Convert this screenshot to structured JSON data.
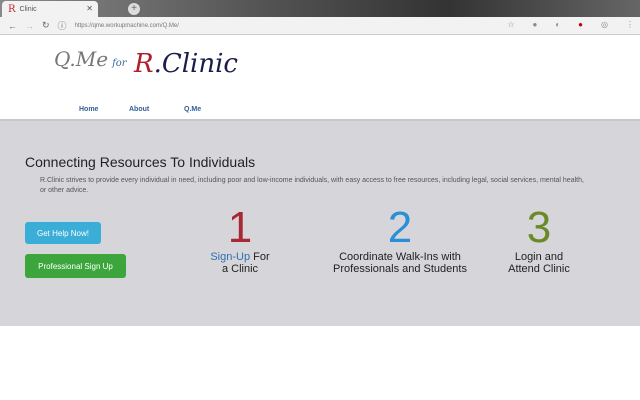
{
  "browser": {
    "tab_title": "Clinic",
    "url": "https://qme.workupmachine.com/Q.Me/"
  },
  "logo": {
    "qme": "Q.Me",
    "for": "for",
    "r": "R",
    "clinic": ".Clinic"
  },
  "nav": [
    "Home",
    "About",
    "Q.Me"
  ],
  "hero": {
    "title": "Connecting Resources To Individuals",
    "description": "R.Clinic strives to provide every individual in need, including poor and low-income individuals, with easy access to free resources, including legal, social services, mental health, or other advice.",
    "get_help": "Get Help Now!",
    "pro_signup": "Professional Sign Up",
    "steps": [
      {
        "num": "1",
        "link": "Sign-Up",
        "text1": " For",
        "text2": "a Clinic",
        "color": "#a82935"
      },
      {
        "num": "2",
        "text1": "Coordinate Walk-Ins with",
        "text2": "Professionals and Students",
        "color": "#2a8fd6"
      },
      {
        "num": "3",
        "text1": "Login and",
        "text2": "Attend Clinic",
        "color": "#6a8a2a"
      }
    ]
  }
}
